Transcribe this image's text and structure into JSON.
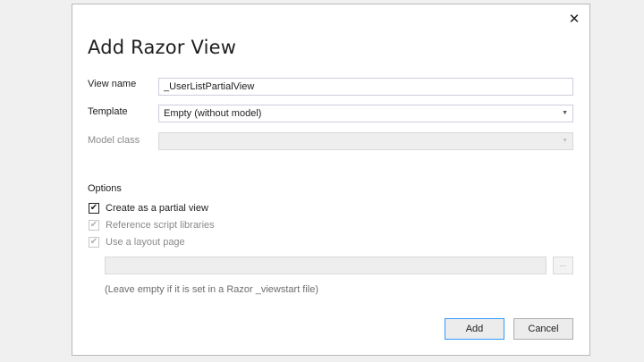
{
  "dialog": {
    "title": "Add Razor View",
    "close_icon": "close-icon"
  },
  "form": {
    "view_name": {
      "label": "View name",
      "value": "_UserListPartialView"
    },
    "template": {
      "label": "Template",
      "value": "Empty (without model)"
    },
    "model_class": {
      "label": "Model class",
      "value": ""
    }
  },
  "options": {
    "heading": "Options",
    "items": [
      {
        "label": "Create as a partial view",
        "checked": true,
        "enabled": true
      },
      {
        "label": "Reference script libraries",
        "checked": true,
        "enabled": false
      },
      {
        "label": "Use a layout page",
        "checked": true,
        "enabled": false
      }
    ],
    "layout_path": "",
    "browse_label": "...",
    "hint": "(Leave empty if it is set in a Razor _viewstart file)"
  },
  "buttons": {
    "add": "Add",
    "cancel": "Cancel"
  },
  "colors": {
    "accent": "#3399ff",
    "disabled_text": "#8a8a8a"
  }
}
